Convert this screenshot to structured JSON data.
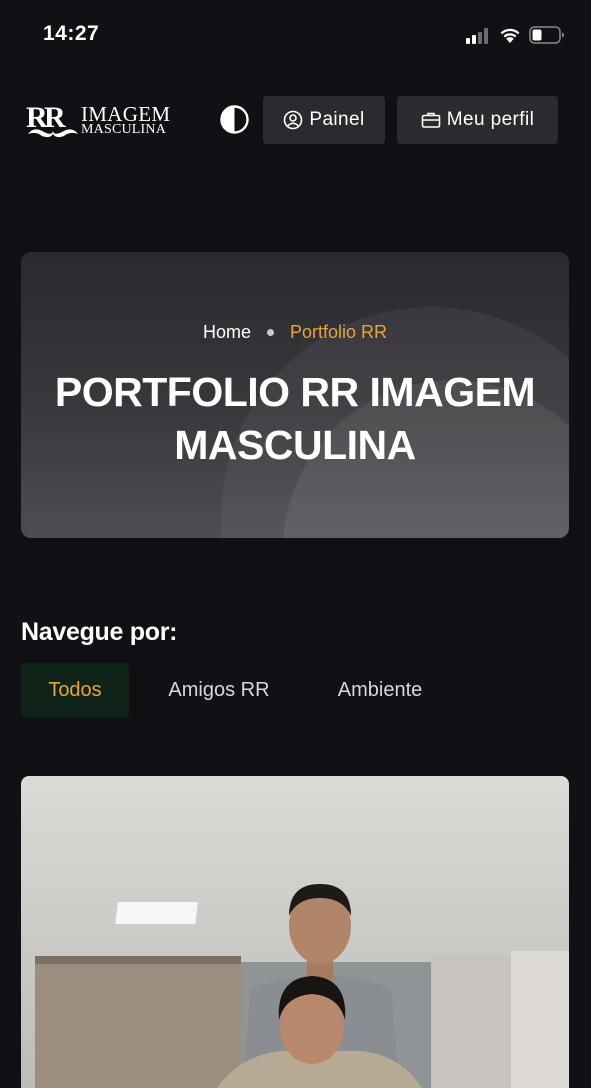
{
  "status_bar": {
    "time": "14:27",
    "icons": [
      "signal-icon",
      "wifi-icon",
      "battery-icon"
    ]
  },
  "header": {
    "logo_line1": "IMAGEM",
    "logo_line2": "MASCULINA",
    "theme_toggle_icon": "contrast-icon",
    "painel_label": "Painel",
    "painel_icon": "user-circle-icon",
    "perfil_label": "Meu perfil",
    "perfil_icon": "briefcase-icon"
  },
  "hero": {
    "breadcrumb_home": "Home",
    "breadcrumb_current": "Portfolio RR",
    "title": "PORTFOLIO RR IMAGEM MASCULINA"
  },
  "navigation": {
    "heading": "Navegue por:",
    "filters": [
      {
        "label": "Todos",
        "active": true
      },
      {
        "label": "Amigos RR",
        "active": false
      },
      {
        "label": "Ambiente",
        "active": false
      }
    ]
  },
  "colors": {
    "background": "#111015",
    "accent": "#e9a43b",
    "active_filter_bg": "#0f2319",
    "button_bg": "#2a2a2f"
  }
}
